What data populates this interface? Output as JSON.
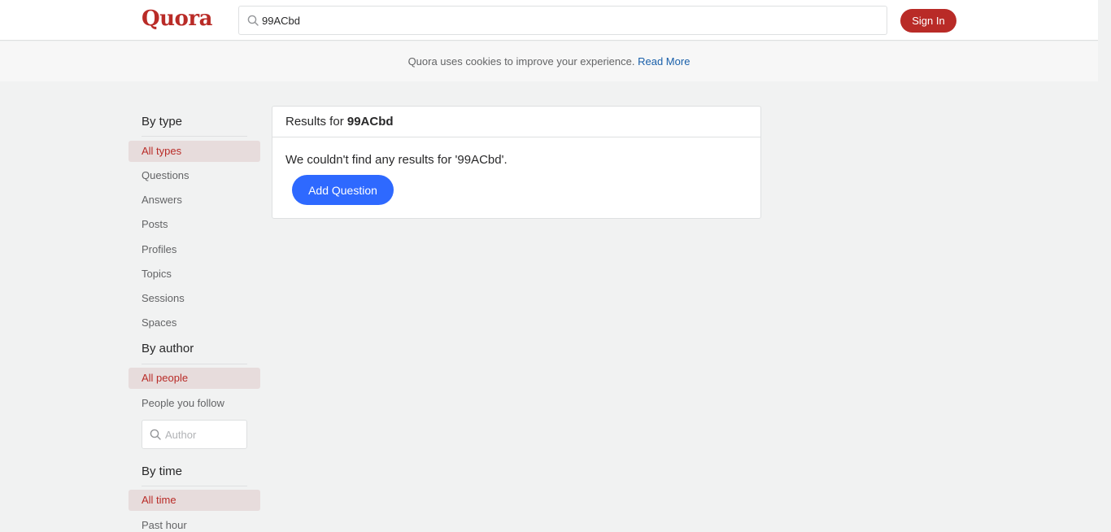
{
  "header": {
    "logo": "Quora",
    "search_value": "99ACbd",
    "signin_label": "Sign In"
  },
  "cookie_banner": {
    "text": "Quora uses cookies to improve your experience.",
    "link": "Read More"
  },
  "sidebar": {
    "by_type": {
      "title": "By type",
      "items": [
        "All types",
        "Questions",
        "Answers",
        "Posts",
        "Profiles",
        "Topics",
        "Sessions",
        "Spaces"
      ],
      "selected": "All types"
    },
    "by_author": {
      "title": "By author",
      "items": [
        "All people",
        "People you follow"
      ],
      "selected": "All people",
      "author_placeholder": "Author"
    },
    "by_time": {
      "title": "By time",
      "items": [
        "All time",
        "Past hour"
      ],
      "selected": "All time"
    }
  },
  "results": {
    "header_prefix": "Results for",
    "query": "99ACbd",
    "no_results_text": "We couldn't find any results for '99ACbd'.",
    "add_question_label": "Add Question"
  },
  "colors": {
    "brand": "#b92b27",
    "primary_button": "#2e69ff",
    "active_filter_bg": "#e7dcdc"
  }
}
